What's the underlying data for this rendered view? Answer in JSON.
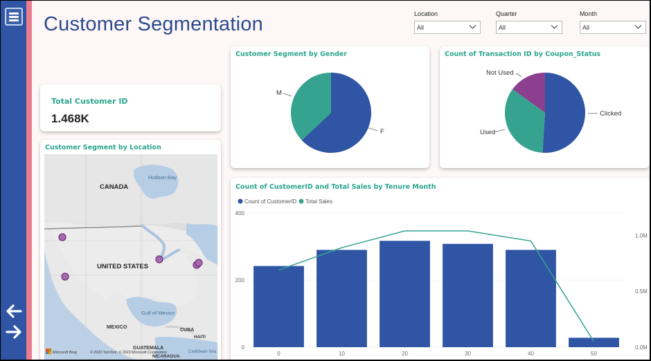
{
  "page": {
    "title": "Customer Segmentation"
  },
  "slicers": [
    {
      "label": "Location",
      "value": "All"
    },
    {
      "label": "Quarter",
      "value": "All"
    },
    {
      "label": "Month",
      "value": "All"
    }
  ],
  "kpi": {
    "label": "Total Customer ID",
    "value": "1.468K"
  },
  "location_map": {
    "title": "Customer Segment by Location",
    "labels": {
      "canada": "CANADA",
      "us": "UNITED STATES",
      "mexico": "MEXICO",
      "hudson": "Hudson Bay",
      "gulf": "Gulf of Mexico",
      "cuba": "CUBA",
      "haiti": "HAITI",
      "guatemala": "GUATEMALA",
      "nicaragua": "NICARAGUA",
      "caribbean": "Caribbean Sea"
    },
    "credits": {
      "bing": "Microsoft Bing",
      "copyright": "© 2023 TomTom, © 2023 Microsoft Corporation"
    }
  },
  "colors": {
    "blue": "#2f55a4",
    "teal": "#35a38f",
    "purple": "#8b3f8e",
    "pink": "#e87d8f",
    "accent_text": "#2ba58d"
  },
  "chart_data": [
    {
      "type": "pie",
      "title": "Customer Segment by Gender",
      "labels": [
        "F",
        "M"
      ],
      "values": [
        63,
        37
      ]
    },
    {
      "type": "pie",
      "title": "Count of Transaction ID by Coupon_Status",
      "labels": [
        "Clicked",
        "Used",
        "Not Used"
      ],
      "values": [
        51,
        34,
        15
      ]
    },
    {
      "type": "bar",
      "title": "Count of CustomerID and Total Sales by Tenure Month",
      "categories": [
        "0",
        "10",
        "20",
        "30",
        "40",
        "50"
      ],
      "series": [
        {
          "name": "Count of CustomerID",
          "type": "bar",
          "axis": "left",
          "values": [
            242,
            290,
            317,
            308,
            290,
            28
          ]
        },
        {
          "name": "Total Sales",
          "type": "line",
          "axis": "right",
          "values": [
            690000,
            890000,
            1040000,
            1040000,
            950000,
            50000
          ]
        }
      ],
      "y_left": {
        "min": 0,
        "max": 400,
        "ticks": [
          "0",
          "200",
          "400"
        ]
      },
      "y_right": {
        "min": 0,
        "max": 1200000,
        "ticks": [
          "0.0M",
          "0.5M",
          "1.0M"
        ]
      },
      "legend_position": "top-left"
    }
  ]
}
